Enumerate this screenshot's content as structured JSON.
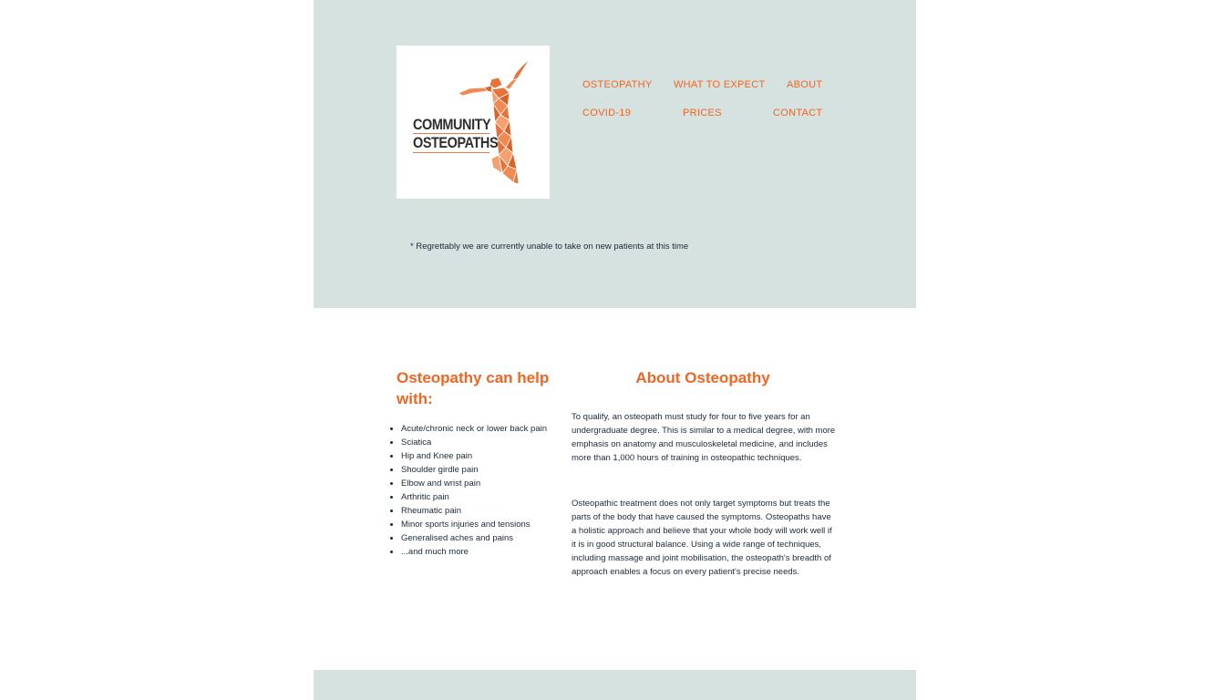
{
  "brand": {
    "logo_line1": "COMMUNITY",
    "logo_line2": "OSTEOPATHS",
    "accent_color": "#f26522",
    "band_color": "#d5e2e0"
  },
  "nav": {
    "items": [
      {
        "label": "OSTEOPATHY"
      },
      {
        "label": "WHAT TO EXPECT"
      },
      {
        "label": "ABOUT"
      },
      {
        "label": "COVID-19"
      },
      {
        "label": "PRICES"
      },
      {
        "label": "CONTACT"
      }
    ]
  },
  "notice": "* Regrettably we are currently unable to take on new patients at this time",
  "help": {
    "heading": "Osteopathy can help with:",
    "items": [
      "Acute/chronic neck or lower back pain",
      "Sciatica",
      "Hip and Knee pain",
      "Shoulder girdle pain",
      "Elbow and wrist pain",
      "Arthritic pain",
      "Rheumatic pain",
      "Minor sports injuries and tensions",
      "Generalised aches and pains",
      "...and much more"
    ]
  },
  "about": {
    "heading": "About Osteopathy",
    "paragraphs": [
      "To qualify, an osteopath must study for four to five years for an undergraduate degree. This is similar to a medical degree, with more emphasis on anatomy and musculoskeletal medicine, and includes more than 1,000 hours of training in osteopathic techniques.",
      "Osteopathic treatment does not only target symptoms but treats the parts of the body that have caused the symptoms. Osteopaths have a holistic approach and believe that your whole body will work well if it is in good structural balance. Using a wide range of techniques, including massage and joint mobilisation, the osteopath's breadth of approach enables a focus on every patient's precise needs."
    ]
  }
}
